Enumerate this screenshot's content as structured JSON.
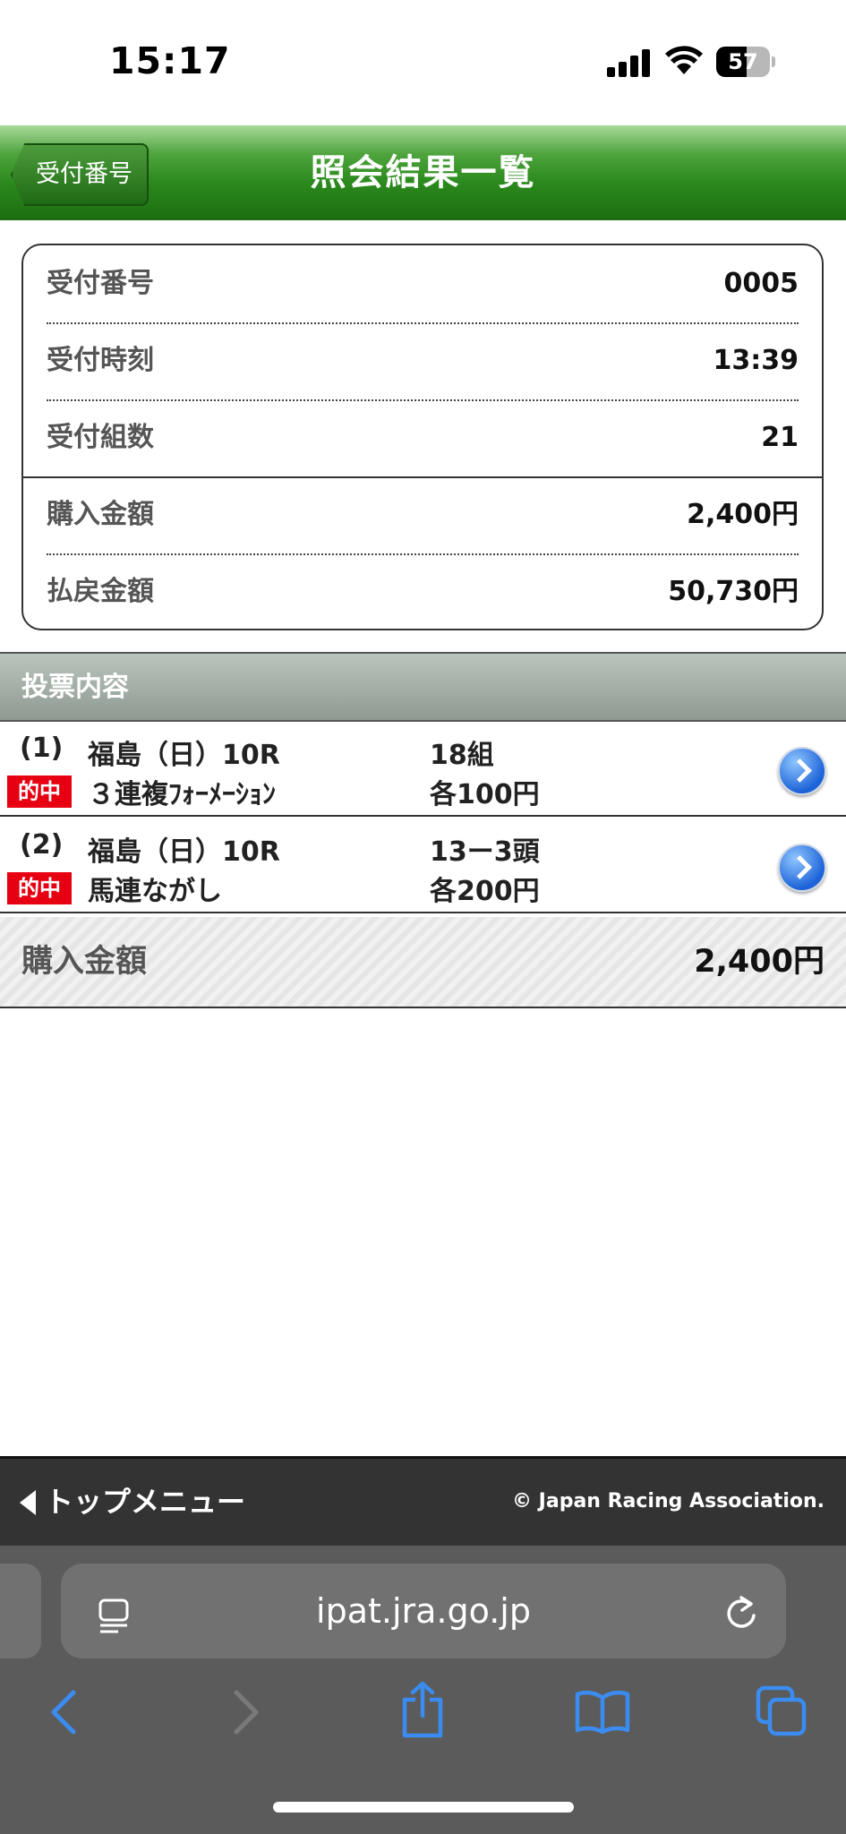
{
  "status_bar": {
    "time": "15:17",
    "battery": "57",
    "battery_level": 0.57
  },
  "header": {
    "back_label": "受付番号",
    "title": "照会結果一覧"
  },
  "summary": {
    "rows": [
      {
        "label": "受付番号",
        "value": "0005"
      },
      {
        "label": "受付時刻",
        "value": "13:39"
      },
      {
        "label": "受付組数",
        "value": "21"
      },
      {
        "label": "購入金額",
        "value": "2,400円"
      },
      {
        "label": "払戻金額",
        "value": "50,730円"
      }
    ]
  },
  "votes": {
    "header": "投票内容",
    "items": [
      {
        "num": "(1)",
        "race": "福島（日）10R",
        "count": "18組",
        "badge": "的中",
        "bet_type": "３連複ﾌｫｰﾒｰｼｮﾝ",
        "unit": "各100円"
      },
      {
        "num": "(2)",
        "race": "福島（日）10R",
        "count": "13ー3頭",
        "badge": "的中",
        "bet_type": "馬連ながし",
        "unit": "各200円"
      }
    ]
  },
  "total": {
    "label": "購入金額",
    "value": "2,400円"
  },
  "footer": {
    "top_menu": "トップメニュー",
    "copyright": "© Japan Racing Association."
  },
  "browser": {
    "url": "ipat.jra.go.jp",
    "accent": "#3b8cf0"
  }
}
